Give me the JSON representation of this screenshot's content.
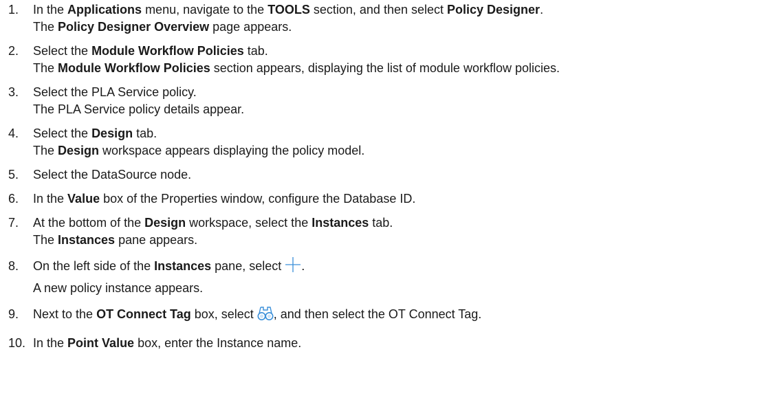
{
  "steps": [
    {
      "num": "1.",
      "p1": "In the ",
      "b1": "Applications",
      "p2": " menu, navigate to the ",
      "b2": "TOOLS",
      "p3": " section, and then select ",
      "b3": "Policy Designer",
      "p4": ".",
      "r1": "The ",
      "rb1": "Policy Designer Overview",
      "r2": " page appears."
    },
    {
      "num": "2.",
      "p1": "Select the ",
      "b1": "Module Workflow Policies",
      "p2": " tab.",
      "r1": "The ",
      "rb1": "Module Workflow Policies",
      "r2": " section appears, displaying the list of module workflow policies."
    },
    {
      "num": "3.",
      "p1": "Select the PLA Service policy.",
      "r1": "The PLA Service policy details appear."
    },
    {
      "num": "4.",
      "p1": "Select the ",
      "b1": "Design",
      "p2": " tab.",
      "r1": "The ",
      "rb1": "Design",
      "r2": " workspace appears displaying the policy model."
    },
    {
      "num": "5.",
      "p1": "Select the DataSource node."
    },
    {
      "num": "6.",
      "p1": "In the ",
      "b1": "Value",
      "p2": " box of the Properties window, configure the Database ID."
    },
    {
      "num": "7.",
      "p1": "At the bottom of the ",
      "b1": "Design",
      "p2": " workspace, select the ",
      "b2": "Instances",
      "p3": " tab.",
      "r1": "The ",
      "rb1": "Instances",
      "r2": " pane appears."
    },
    {
      "num": "8.",
      "p1": "On the left side of the ",
      "b1": "Instances",
      "p2": " pane, select ",
      "icon": "plus-icon",
      "p3": ".",
      "r1": "A new policy instance appears."
    },
    {
      "num": "9.",
      "p1": "Next to the ",
      "b1": "OT Connect Tag",
      "p2": " box, select ",
      "icon": "binoculars-icon",
      "p3": ", and then select the OT Connect Tag."
    },
    {
      "num": "10.",
      "p1": "In the ",
      "b1": "Point Value",
      "p2": " box, enter the Instance name."
    }
  ],
  "colors": {
    "text": "#1a1a1a",
    "icon_blue": "#3a8fd9"
  }
}
